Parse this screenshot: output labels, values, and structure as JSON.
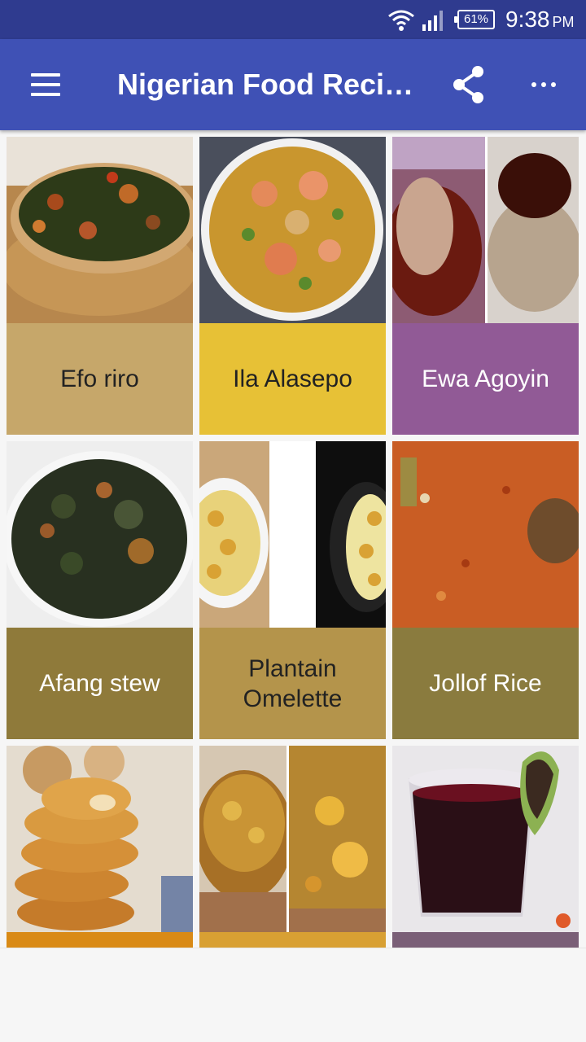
{
  "status_bar": {
    "battery": "61%",
    "time": "9:38",
    "ampm": "PM",
    "icons": [
      "wifi-icon",
      "signal-icon",
      "battery-icon"
    ]
  },
  "app_bar": {
    "title": "Nigerian Food Recipes",
    "icons": [
      "menu-icon",
      "share-icon",
      "more-vert-icon"
    ]
  },
  "recipes": [
    {
      "name": "Efo riro",
      "label_color": "#c6a76a",
      "text_color": "#222222"
    },
    {
      "name": "Ila Alasepo",
      "label_color": "#e7c136",
      "text_color": "#222222"
    },
    {
      "name": "Ewa Agoyin",
      "label_color": "#915a96",
      "text_color": "#ffffff"
    },
    {
      "name": "Afang stew",
      "label_color": "#8f7a3a",
      "text_color": "#ffffff"
    },
    {
      "name": "Plantain Omelette",
      "label_color": "#b4944b",
      "text_color": "#222222"
    },
    {
      "name": "Jollof Rice",
      "label_color": "#8a7b3e",
      "text_color": "#ffffff"
    },
    {
      "name": "",
      "label_color": "#d98a16",
      "text_color": "#ffffff"
    },
    {
      "name": "",
      "label_color": "#d8a033",
      "text_color": "#222222"
    },
    {
      "name": "",
      "label_color": "#7a5f77",
      "text_color": "#ffffff"
    }
  ]
}
